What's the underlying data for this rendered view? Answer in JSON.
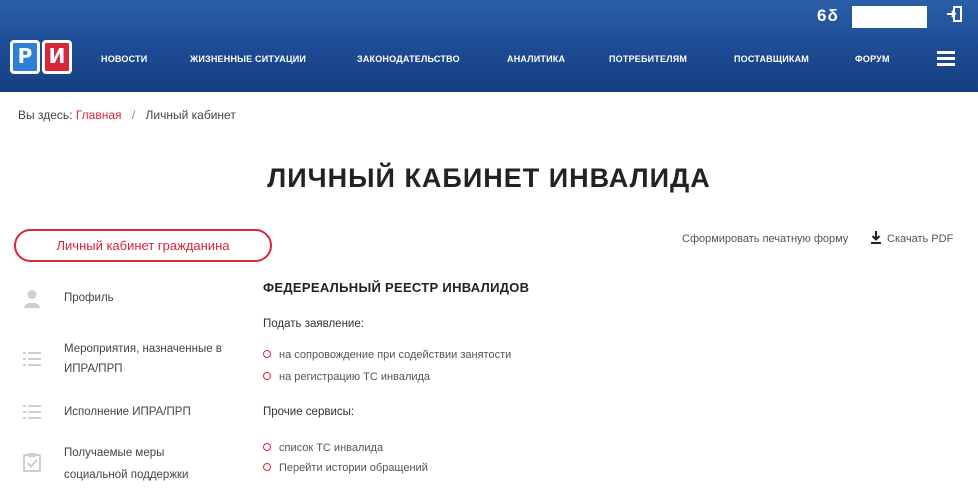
{
  "header": {
    "util_icon_text": "6δ",
    "logo": {
      "letter_left": "Р",
      "letter_right": "И"
    },
    "nav": [
      "НОВОСТИ",
      "ЖИЗНЕННЫЕ СИТУАЦИИ",
      "ЗАКОНОДАТЕЛЬСТВО",
      "АНАЛИТИКА",
      "ПОТРЕБИТЕЛЯМ",
      "ПОСТАВЩИКАМ",
      "ФОРУМ"
    ],
    "colors": {
      "bar": "#1d4b93",
      "logo_blue": "#2f7fd6",
      "logo_red": "#d8263a"
    }
  },
  "breadcrumb": {
    "prefix": "Вы здесь:",
    "home": "Главная",
    "separator": "/",
    "current": "Личный кабинет"
  },
  "page_title": "ЛИЧНЫЙ КАБИНЕТ ИНВАЛИДА",
  "cabinet_button": "Личный кабинет гражданина",
  "actions": {
    "print": "Сформировать печатную форму",
    "pdf": "Скачать PDF",
    "pdf_icon": "download-icon"
  },
  "sidebar": [
    {
      "line1": "Профиль",
      "line2": "",
      "icon": "user-icon"
    },
    {
      "line1": "Мероприятия, назначенные в",
      "line2": "ИПРА/ПРП",
      "icon": "list-icon"
    },
    {
      "line1": "Исполнение ИПРА/ПРП",
      "line2": "",
      "icon": "list-icon"
    },
    {
      "line1": "Получаемые меры",
      "line2": "социальной поддержки",
      "icon": "clipboard-check-icon"
    }
  ],
  "main": {
    "section_title": "ФЕДЕРЕАЛЬНЫЙ РЕЕСТР ИНВАЛИДОВ",
    "apply_heading": "Подать заявление:",
    "apply_links": [
      "на сопровождение при содействии занятости",
      "на регистрацию ТС инвалида"
    ],
    "other_heading": "Прочие сервисы:",
    "other_links": [
      "список ТС инвалида",
      "Перейти истории обращений"
    ]
  },
  "accent_color": "#d8263a"
}
